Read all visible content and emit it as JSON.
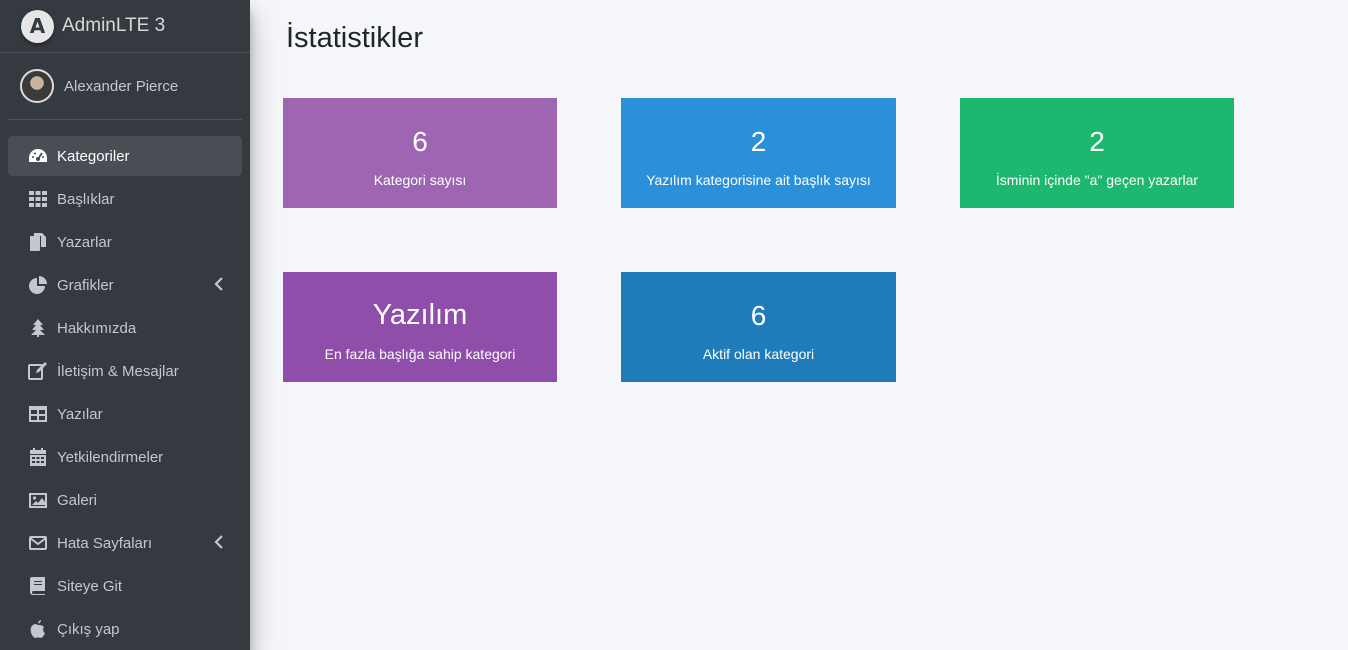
{
  "brand": {
    "name": "AdminLTE 3",
    "logo_letter": "A"
  },
  "user": {
    "name": "Alexander Pierce"
  },
  "sidebar": {
    "items": [
      {
        "label": "Kategoriler",
        "icon": "tachometer-icon",
        "active": true
      },
      {
        "label": "Başlıklar",
        "icon": "th-icon"
      },
      {
        "label": "Yazarlar",
        "icon": "copy-icon"
      },
      {
        "label": "Grafikler",
        "icon": "chart-pie-icon",
        "has_submenu": true
      },
      {
        "label": "Hakkımızda",
        "icon": "tree-icon"
      },
      {
        "label": "İletişim & Mesajlar",
        "icon": "edit-icon"
      },
      {
        "label": "Yazılar",
        "icon": "table-icon"
      },
      {
        "label": "Yetkilendirmeler",
        "icon": "calendar-icon"
      },
      {
        "label": "Galeri",
        "icon": "image-icon"
      },
      {
        "label": "Hata Sayfaları",
        "icon": "envelope-icon",
        "has_submenu": true
      },
      {
        "label": "Siteye Git",
        "icon": "book-icon"
      },
      {
        "label": "Çıkış yap",
        "icon": "apple-icon"
      }
    ]
  },
  "main": {
    "title": "İstatistikler",
    "stats": [
      {
        "value": "6",
        "label": "Kategori sayısı",
        "color": "#9e66b2"
      },
      {
        "value": "2",
        "label": "Yazılım kategorisine ait başlık sayısı",
        "color": "#2a90d9"
      },
      {
        "value": "2",
        "label": "İsminin içinde \"a\" geçen yazarlar",
        "color": "#1eb76f"
      },
      {
        "value": "Yazılım",
        "label": "En fazla başlığa sahip kategori",
        "color": "#8e4ea9"
      },
      {
        "value": "6",
        "label": "Aktif olan kategori",
        "color": "#1f7bba"
      }
    ]
  }
}
